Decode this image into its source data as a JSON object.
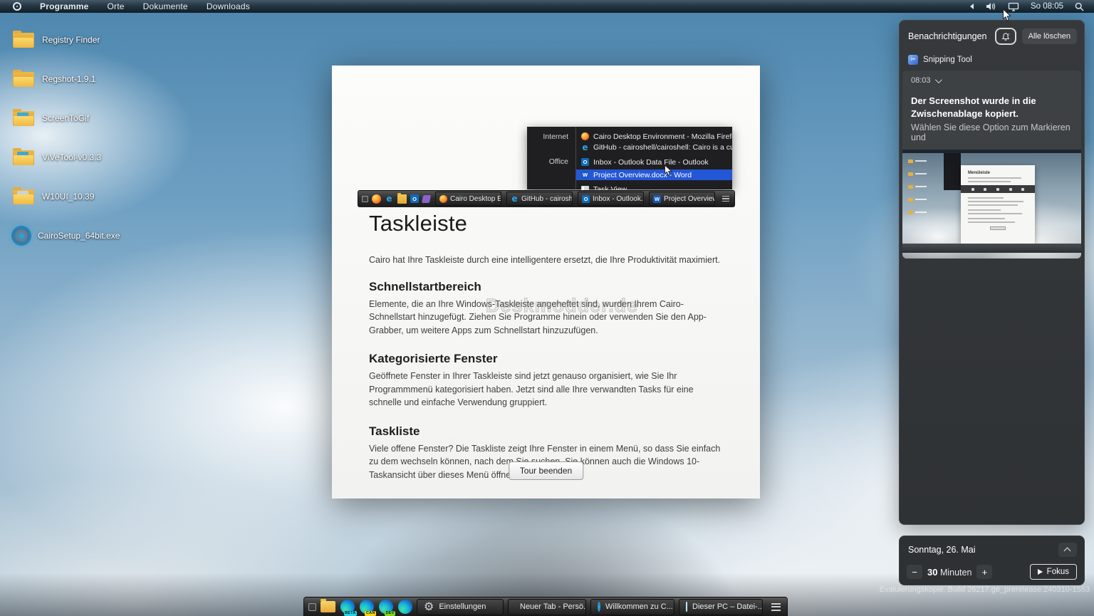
{
  "menubar": {
    "items": [
      "Programme",
      "Orte",
      "Dokumente",
      "Downloads"
    ],
    "clock": "So 08:05"
  },
  "desktop_icons": [
    {
      "label": "Registry Finder",
      "type": "folder"
    },
    {
      "label": "Regshot-1.9.1",
      "type": "folder"
    },
    {
      "label": "ScreenToGif",
      "type": "folder-media"
    },
    {
      "label": "ViVeTool-v0.3.3",
      "type": "folder-media"
    },
    {
      "label": "W10UI_10.39",
      "type": "folder-media"
    },
    {
      "label": "CairoSetup_64bit.exe",
      "type": "cairo-app"
    }
  ],
  "tour_window": {
    "title": "Taskleiste",
    "intro": "Cairo hat Ihre Taskleiste durch eine intelligentere ersetzt, die Ihre Produktivität maximiert.",
    "sections": [
      {
        "heading": "Schnellstartbereich",
        "body": "Elemente, die an Ihre Windows-Taskleiste angeheftet sind, wurden Ihrem Cairo-Schnellstart hinzugefügt. Ziehen Sie Programme hinein oder verwenden Sie den App-Grabber, um weitere Apps zum Schnellstart hinzuzufügen."
      },
      {
        "heading": "Kategorisierte Fenster",
        "body": "Geöffnete Fenster in Ihrer Taskleiste sind jetzt genauso organisiert, wie Sie Ihr Programmmenü kategorisiert haben. Jetzt sind alle Ihre verwandten Tasks für eine schnelle und einfache Verwendung gruppiert."
      },
      {
        "heading": "Taskliste",
        "body": "Viele offene Fenster? Die Taskliste zeigt Ihre Fenster in einem Menü, so dass Sie einfach zu dem wechseln können, nach dem Sie suchen. Sie können auch die Windows 10-Taskansicht über dieses Menü öffnen."
      }
    ],
    "button": "Tour beenden",
    "watermark": "Deskmodder.de"
  },
  "screenshot": {
    "menu": {
      "categories": [
        {
          "label": "Internet"
        },
        {
          "label": "Office"
        }
      ],
      "items": [
        {
          "icon": "firefox",
          "label": "Cairo Desktop Environment - Mozilla Firefox"
        },
        {
          "icon": "edge-legacy",
          "label": "GitHub - cairoshell/cairoshell: Cairo is a customizable, int..."
        },
        {
          "icon": "outlook",
          "label": "Inbox - Outlook Data File - Outlook"
        },
        {
          "icon": "word",
          "label": "Project Overview.docx - Word",
          "selected": true
        },
        {
          "icon": "task-view",
          "label": "Task View"
        }
      ]
    },
    "taskbar": {
      "buttons": [
        {
          "icon": "firefox",
          "label": "Cairo Desktop En..."
        },
        {
          "icon": "edge-legacy",
          "label": "GitHub - cairoshe..."
        },
        {
          "icon": "outlook",
          "label": "Inbox - Outlook..."
        },
        {
          "icon": "word",
          "label": "Project Overview..."
        }
      ]
    }
  },
  "notifications": {
    "title": "Benachrichtigungen",
    "clear_all": "Alle löschen",
    "app": "Snipping Tool",
    "time": "08:03",
    "message_bold": "Der Screenshot wurde in die Zwischenablage kopiert.",
    "message_secondary": "Wählen Sie diese Option zum Markieren und",
    "thumbnail_title": "Menüleiste"
  },
  "calendar": {
    "date": "Sonntag, 26. Mai",
    "minutes": "30",
    "minutes_label": "Minuten",
    "focus": "Fokus"
  },
  "system_watermark": "Evaluierungskopie. Build 26217.ge_prerelease.240310-1553",
  "taskbar": {
    "buttons": [
      {
        "icon": "gear",
        "label": "Einstellungen"
      },
      {
        "icon": "edge",
        "label": "Neuer Tab - Persö..."
      },
      {
        "icon": "cairo",
        "label": "Willkommen zu C..."
      },
      {
        "icon": "monitor",
        "label": "Dieser PC – Datei-..."
      }
    ]
  },
  "colors": {
    "selection_blue": "#2457d6",
    "cairo_blue": "#2aa2de",
    "folder_yellow": "#eeb944"
  }
}
